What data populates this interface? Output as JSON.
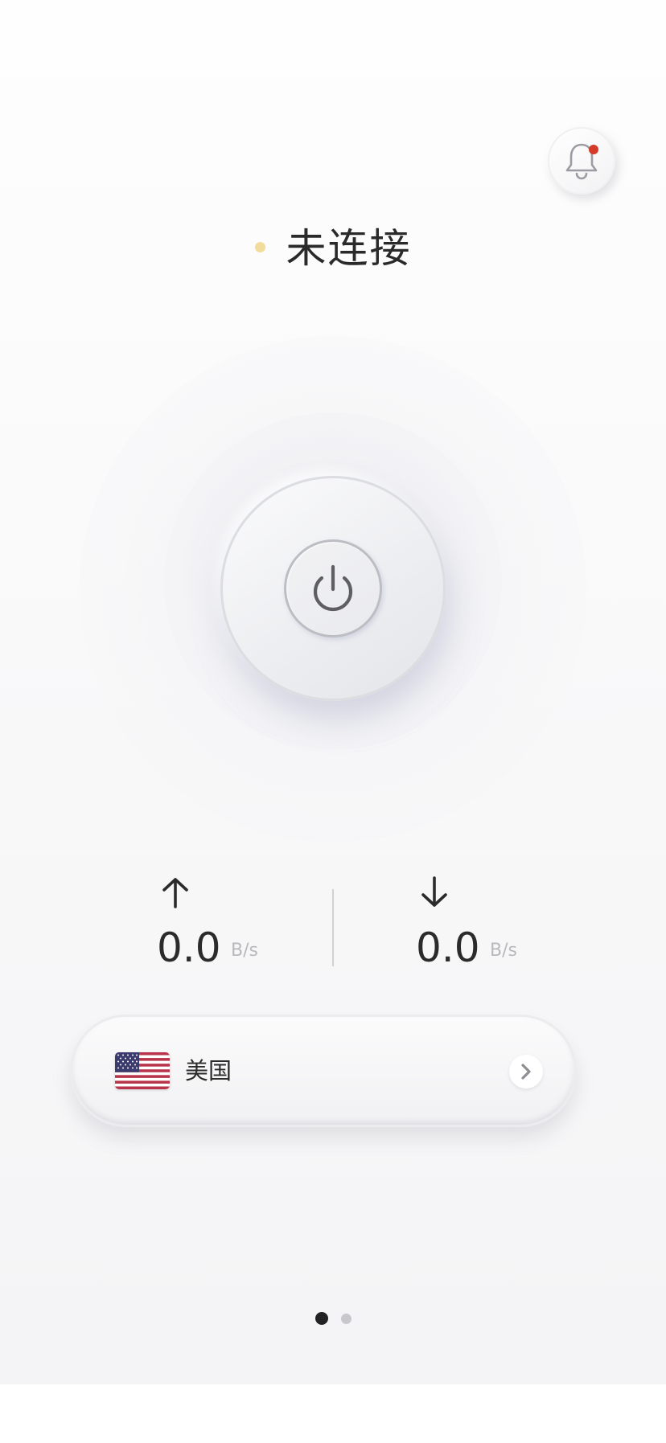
{
  "header": {
    "bell_icon": "bell-icon",
    "has_notification": true,
    "notification_color": "#d4392a"
  },
  "status": {
    "text": "未连接",
    "dot_color": "#f1dc9c"
  },
  "power": {
    "icon": "power-icon"
  },
  "speed": {
    "upload": {
      "icon": "arrow-up-icon",
      "value": "0.0",
      "unit": "B/s"
    },
    "download": {
      "icon": "arrow-down-icon",
      "value": "0.0",
      "unit": "B/s"
    }
  },
  "server": {
    "flag_icon": "us-flag-icon",
    "name": "美国",
    "chevron_icon": "chevron-right-icon"
  },
  "pager": {
    "pages": 2,
    "active_index": 0
  }
}
